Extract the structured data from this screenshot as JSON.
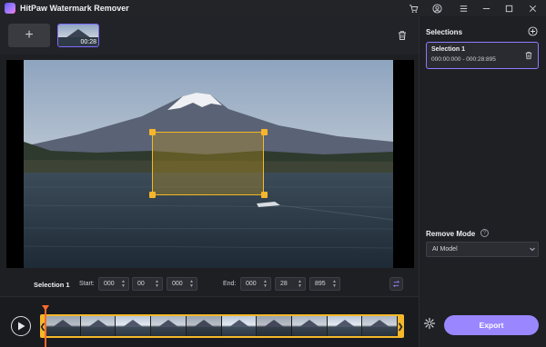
{
  "app": {
    "title": "HitPaw Watermark Remover"
  },
  "titlebar": {
    "icons": [
      "cart-icon",
      "account-icon",
      "menu-icon",
      "minimize-icon",
      "maximize-icon",
      "close-icon"
    ]
  },
  "media": {
    "add_label": "+",
    "thumb_duration": "00:28"
  },
  "time_controls": {
    "selection_label": "Selection 1",
    "start_label": "Start:",
    "start": [
      "000",
      "00",
      "000"
    ],
    "end_label": "End:",
    "end": [
      "000",
      "28",
      "895"
    ]
  },
  "selections_panel": {
    "title": "Selections",
    "items": [
      {
        "title": "Selection 1",
        "range": "000:00:000 - 000:28:895"
      }
    ]
  },
  "remove_mode": {
    "label": "Remove Mode",
    "help": "?",
    "value": "AI Model"
  },
  "export": {
    "label": "Export"
  },
  "colors": {
    "accent": "#9a86ff",
    "selection": "#f3b92a",
    "playhead": "#ff6a2b"
  }
}
